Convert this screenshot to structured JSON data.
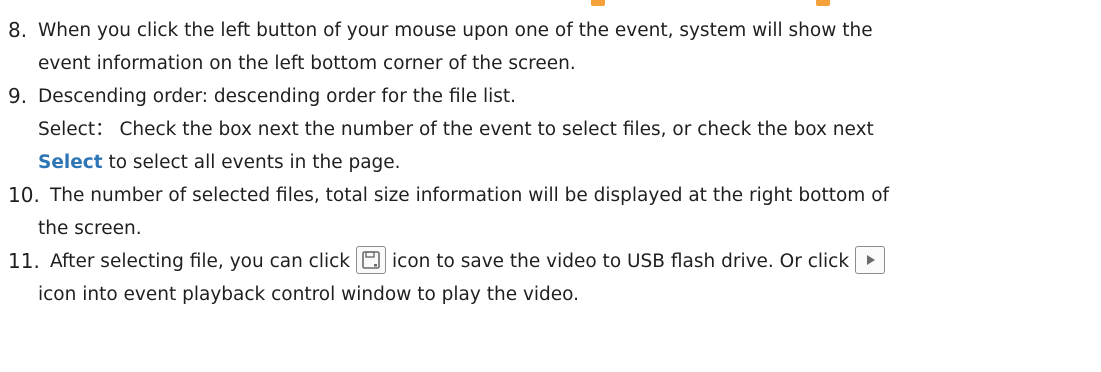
{
  "items": [
    {
      "num": "8.",
      "line1": "When you click the left button of your mouse upon one of the event, system will show the",
      "line2": "event information on the left bottom corner of the screen."
    },
    {
      "num": "9.",
      "line1": "Descending order: descending order for the file list.",
      "line2": "Select： Check the box next the number of the event to select files, or check the box next",
      "line3_link": "Select",
      "line3_rest": " to select all events in the page."
    },
    {
      "num": "10.",
      "line1": "The number of selected files, total size information will be displayed at the right bottom of",
      "line2": "the screen."
    },
    {
      "num": "11.",
      "line1_a": "After selecting file, you can click",
      "line1_b": "icon to save the video to USB flash drive. Or click",
      "line2": "icon into event playback control window to play the video."
    }
  ],
  "icons": {
    "save": "save-icon",
    "play": "play-icon"
  },
  "colors": {
    "link": "#2e75b6",
    "text": "#1f1f1f",
    "accent": "#f5a23a"
  }
}
